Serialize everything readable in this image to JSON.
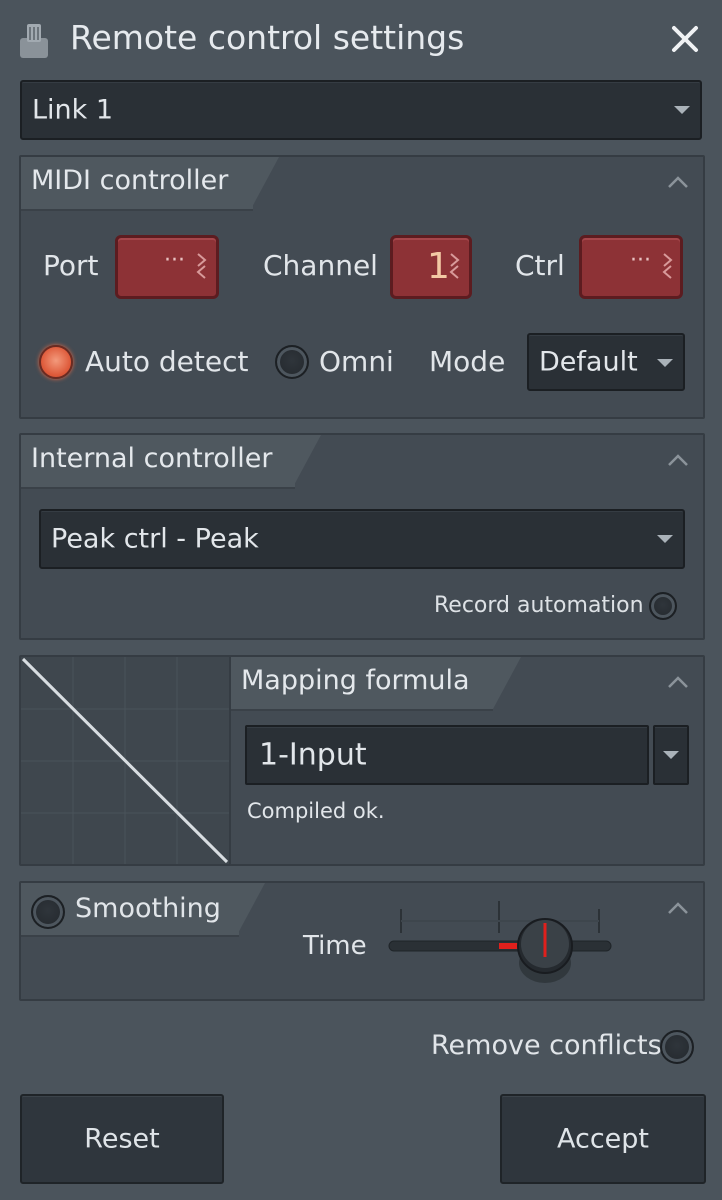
{
  "window": {
    "title": "Remote control settings",
    "title_icon": "knob-icon",
    "close_icon": "close-icon"
  },
  "link_select": {
    "value": "Link 1"
  },
  "midi_controller": {
    "title": "MIDI controller",
    "port_label": "Port",
    "port_value": "···",
    "channel_label": "Channel",
    "channel_value": "1",
    "ctrl_label": "Ctrl",
    "ctrl_value": "···",
    "auto_detect_label": "Auto detect",
    "auto_detect_selected": true,
    "omni_label": "Omni",
    "omni_selected": false,
    "mode_label": "Mode",
    "mode_value": "Default"
  },
  "internal_controller": {
    "title": "Internal controller",
    "selected": "Peak ctrl - Peak",
    "record_automation_label": "Record automation"
  },
  "mapping_formula": {
    "title": "Mapping formula",
    "formula": "1-Input",
    "status": "Compiled ok."
  },
  "smoothing": {
    "label": "Smoothing",
    "enabled": false,
    "time_label": "Time"
  },
  "footer": {
    "remove_conflicts_label": "Remove conflicts",
    "reset_label": "Reset",
    "accept_label": "Accept"
  },
  "colors": {
    "background": "#4b545c",
    "panel": "#434b53",
    "field_dark": "#2a3036",
    "accent_red": "#8d3236",
    "radio_active": "#de5a3a",
    "knob_indicator": "#e0201c"
  }
}
